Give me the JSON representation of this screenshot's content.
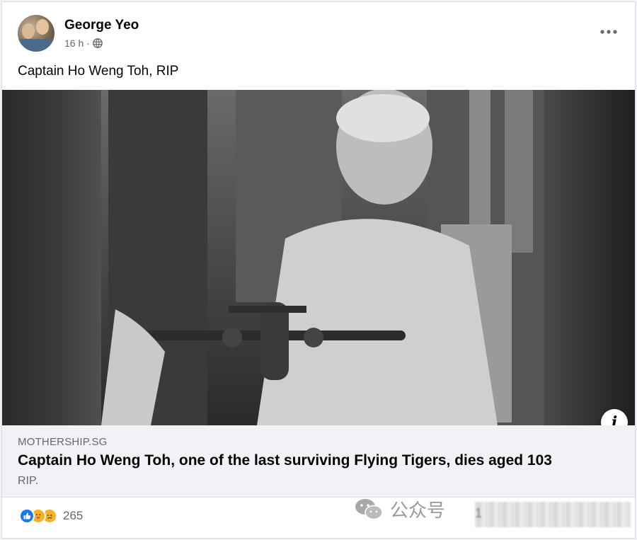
{
  "post": {
    "author": "George Yeo",
    "time": "16 h",
    "text": "Captain Ho Weng Toh, RIP"
  },
  "link": {
    "domain": "MOTHERSHIP.SG",
    "title": "Captain Ho Weng Toh, one of the last surviving Flying Tigers, dies aged 103",
    "subtitle": "RIP."
  },
  "reactions": {
    "count": "265",
    "types": [
      "like-icon",
      "care-icon",
      "sad-icon"
    ]
  },
  "watermark": {
    "text": "公众号",
    "partial_digit": "1"
  },
  "icons": {
    "more": "more-options-icon",
    "privacy": "globe-icon",
    "info": "info-icon"
  },
  "colors": {
    "like_blue": "#1877f2",
    "emoji_yellow": "#f7b125",
    "text_primary": "#050505",
    "text_secondary": "#65676b",
    "link_bg": "#f0f2f5"
  }
}
